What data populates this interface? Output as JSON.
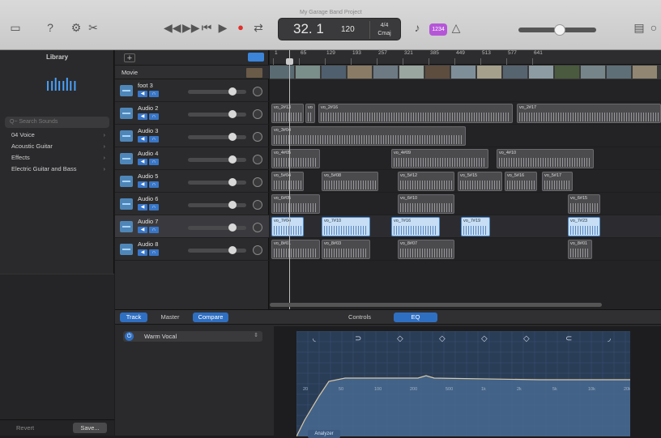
{
  "toolbar": {
    "lcd_status": "My Garage Band Project",
    "lcd_bar": "32. 1",
    "lcd_tempo": "120",
    "lcd_signature_top": "4/4",
    "lcd_signature_bottom": "Cmaj",
    "count_in_label": "1234",
    "master_volume": 0.55
  },
  "library": {
    "title": "Library",
    "search_placeholder": "Q~ Search Sounds",
    "items": [
      {
        "label": "04 Voice"
      },
      {
        "label": "Acoustic Guitar"
      },
      {
        "label": "Effects"
      },
      {
        "label": "Electric Guitar and Bass"
      }
    ],
    "revert_label": "Revert",
    "save_label": "Save..."
  },
  "tracks": {
    "movie_label": "Movie",
    "items": [
      {
        "name": "foot 3"
      },
      {
        "name": "Audio 2"
      },
      {
        "name": "Audio 3"
      },
      {
        "name": "Audio 4"
      },
      {
        "name": "Audio 5"
      },
      {
        "name": "Audio 6"
      },
      {
        "name": "Audio 7"
      },
      {
        "name": "Audio 8"
      }
    ]
  },
  "ruler": {
    "labels": [
      "1",
      "65",
      "129",
      "193",
      "257",
      "321",
      "385",
      "449",
      "513",
      "577",
      "641"
    ]
  },
  "regions": [
    {
      "lane": 1,
      "label": "vo_2#13"
    },
    {
      "lane": 1,
      "label": "vo"
    },
    {
      "lane": 1,
      "label": "vo_2#16"
    },
    {
      "lane": 1,
      "label": "vo_2#17"
    },
    {
      "lane": 2,
      "label": "vo_3#04"
    },
    {
      "lane": 3,
      "label": "vo_4#05"
    },
    {
      "lane": 3,
      "label": "vo_4#09"
    },
    {
      "lane": 3,
      "label": "vo_4#10"
    },
    {
      "lane": 4,
      "label": "vo_5#04"
    },
    {
      "lane": 4,
      "label": "vo_5#08"
    },
    {
      "lane": 4,
      "label": "vo_5#12"
    },
    {
      "lane": 4,
      "label": "vo_5#15"
    },
    {
      "lane": 4,
      "label": "vo_5#16"
    },
    {
      "lane": 4,
      "label": "vo_5#17"
    },
    {
      "lane": 5,
      "label": "vo_6#05"
    },
    {
      "lane": 5,
      "label": "vo_6#10"
    },
    {
      "lane": 5,
      "label": "vo_6#15"
    },
    {
      "lane": 6,
      "label": "vo_7#04"
    },
    {
      "lane": 6,
      "label": "vo_7#10"
    },
    {
      "lane": 6,
      "label": "vo_7#16"
    },
    {
      "lane": 6,
      "label": "vo_7#19"
    },
    {
      "lane": 6,
      "label": "vo_7#23"
    },
    {
      "lane": 7,
      "label": "vo_8#01"
    },
    {
      "lane": 7,
      "label": "vo_8#03"
    },
    {
      "lane": 7,
      "label": "vo_8#07"
    },
    {
      "lane": 7,
      "label": "vo_8#01"
    }
  ],
  "editor": {
    "tab_track": "Track",
    "tab_master": "Master",
    "tab_compare": "Compare",
    "tab_controls": "Controls",
    "tab_eq": "EQ",
    "preset_name": "Warm Vocal",
    "analyzer_label": "Analyzer",
    "eq_freq_labels": [
      "20",
      "50",
      "100",
      "200",
      "500",
      "1k",
      "2k",
      "5k",
      "10k",
      "20k"
    ]
  },
  "colors": {
    "accent_blue": "#2f6fc2",
    "region_selected": "#c8def4",
    "record_red": "#e0302a",
    "count_in_purple": "#b556d8"
  }
}
